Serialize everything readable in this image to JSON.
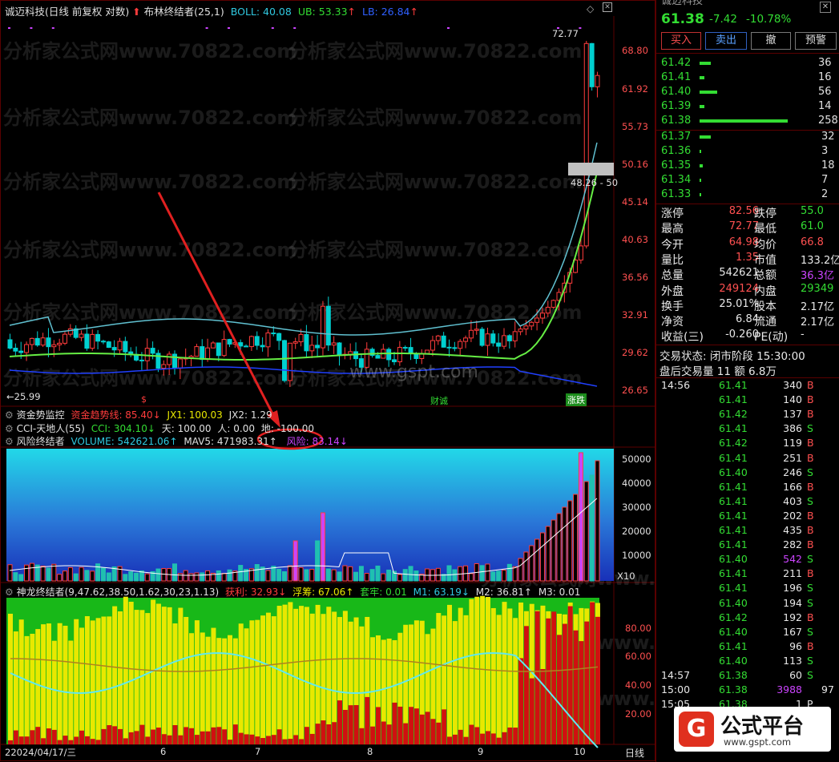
{
  "colors": {
    "up": "#ff3c3c",
    "down": "#00d0d0",
    "green": "#33dd33",
    "yellow": "#e8e800",
    "text": "#c8c8c8",
    "border": "#5a0000",
    "purple": "#cc44ff",
    "blue": "#3060ff",
    "cyan": "#30c8e0"
  },
  "header": {
    "stock": "诚迈科技",
    "mode": "(日线 前复权 对数)",
    "indicator": "布林终结者(25,1)",
    "boll_label": "BOLL: 40.08",
    "ub_label": "UB: 53.33",
    "lb_label": "LB: 26.84"
  },
  "main_chart": {
    "price_axis": [
      "68.80",
      "61.92",
      "55.73",
      "50.16",
      "45.14",
      "40.63",
      "36.56",
      "32.91",
      "29.62",
      "26.65"
    ],
    "high_label": "72.77",
    "low_label": "←25.99",
    "range_label": "48.26 - 50",
    "watermark_main": "分析家公式网www.70822.com",
    "watermark_site": "www.gspt.com",
    "tag_low": "$",
    "tag_cai": "财诚",
    "tag_zhangdie": "涨跌"
  },
  "indicators": {
    "row1": {
      "name": "资金势监控",
      "a": "资金趋势线: 85.40↓",
      "b": "JX1: 100.03",
      "c": "JX2: 1.29"
    },
    "row2": {
      "name": "CCI-天地人(55)",
      "a": "CCI: 304.10↓",
      "b": "天: 100.00",
      "c": "人: 0.00",
      "d": "地: -100.00"
    },
    "row3": {
      "name": "风险终结者",
      "a": "VOLUME: 542621.06↑",
      "b": "MAV5: 471983.31↑",
      "c": "风险: 83.14↓"
    }
  },
  "volume_panel": {
    "axis": [
      "50000",
      "40000",
      "30000",
      "20000",
      "10000"
    ],
    "unit": "X10"
  },
  "dragon_panel": {
    "title": "神龙终结者(9,47.62,38.50,1.62,30,23,1.13)",
    "a": "获利: 32.93↓",
    "b": "浮筹: 67.06↑",
    "c": "套牢: 0.01",
    "d": "M1: 63.19↓",
    "e": "M2: 36.81↑",
    "f": "M3: 0.01",
    "axis": [
      "80.00",
      "60.00",
      "40.00",
      "20.00"
    ]
  },
  "date_axis": {
    "start": "22024/04/17/三",
    "months": [
      "6",
      "7",
      "8",
      "9",
      "10"
    ],
    "period": "日线"
  },
  "side": {
    "name_partial": "诚迈科技",
    "price": "61.38",
    "change": "-7.42",
    "pct": "-10.78%",
    "buttons": [
      "买入",
      "卖出",
      "撤",
      "预警"
    ],
    "asks": [
      {
        "p": "61.42",
        "v": "36"
      },
      {
        "p": "61.41",
        "v": "16"
      },
      {
        "p": "61.40",
        "v": "56"
      },
      {
        "p": "61.39",
        "v": "14"
      },
      {
        "p": "61.38",
        "v": "258"
      }
    ],
    "bids": [
      {
        "p": "61.37",
        "v": "32"
      },
      {
        "p": "61.36",
        "v": "3"
      },
      {
        "p": "61.35",
        "v": "18"
      },
      {
        "p": "61.34",
        "v": "7"
      },
      {
        "p": "61.33",
        "v": "2"
      }
    ],
    "info": [
      {
        "k1": "涨停",
        "v1": "82.56",
        "k2": "跌停",
        "v2": "55.0"
      },
      {
        "k1": "最高",
        "v1": "72.77",
        "k2": "最低",
        "v2": "61.0"
      },
      {
        "k1": "今开",
        "v1": "64.98",
        "k2": "均价",
        "v2": "66.8"
      },
      {
        "k1": "量比",
        "v1": "1.35",
        "k2": "市值",
        "v2": "133.2亿"
      },
      {
        "k1": "总量",
        "v1": "542621",
        "k2": "总额",
        "v2": "36.3亿"
      },
      {
        "k1": "外盘",
        "v1": "249124",
        "k2": "内盘",
        "v2": "29349"
      },
      {
        "k1": "换手",
        "v1": "25.01%",
        "k2": "股本",
        "v2": "2.17亿"
      },
      {
        "k1": "净资",
        "v1": "6.84",
        "k2": "流通",
        "v2": "2.17亿"
      },
      {
        "k1": "收益(三)",
        "v1": "-0.260",
        "k2": "PE(动)",
        "v2": "-"
      }
    ],
    "status1": "交易状态: 闭市阶段 15:30:00",
    "status2": "盘后交易量 11 额 6.8万",
    "ticks": [
      {
        "t": "14:56",
        "p": "61.41",
        "v": "340",
        "d": "B"
      },
      {
        "t": "",
        "p": "61.41",
        "v": "140",
        "d": "B"
      },
      {
        "t": "",
        "p": "61.42",
        "v": "137",
        "d": "B"
      },
      {
        "t": "",
        "p": "61.41",
        "v": "386",
        "d": "S"
      },
      {
        "t": "",
        "p": "61.42",
        "v": "119",
        "d": "B"
      },
      {
        "t": "",
        "p": "61.41",
        "v": "251",
        "d": "B"
      },
      {
        "t": "",
        "p": "61.40",
        "v": "246",
        "d": "S"
      },
      {
        "t": "",
        "p": "61.41",
        "v": "166",
        "d": "B"
      },
      {
        "t": "",
        "p": "61.41",
        "v": "403",
        "d": "S"
      },
      {
        "t": "",
        "p": "61.41",
        "v": "202",
        "d": "B"
      },
      {
        "t": "",
        "p": "61.41",
        "v": "435",
        "d": "B"
      },
      {
        "t": "",
        "p": "61.41",
        "v": "282",
        "d": "B"
      },
      {
        "t": "",
        "p": "61.40",
        "v": "542",
        "d": "S"
      },
      {
        "t": "",
        "p": "61.41",
        "v": "211",
        "d": "B"
      },
      {
        "t": "",
        "p": "61.41",
        "v": "196",
        "d": "S"
      },
      {
        "t": "",
        "p": "61.40",
        "v": "194",
        "d": "S"
      },
      {
        "t": "",
        "p": "61.42",
        "v": "192",
        "d": "B"
      },
      {
        "t": "",
        "p": "61.40",
        "v": "167",
        "d": "S"
      },
      {
        "t": "",
        "p": "61.41",
        "v": "96",
        "d": "B"
      },
      {
        "t": "",
        "p": "61.40",
        "v": "113",
        "d": "S"
      },
      {
        "t": "14:57",
        "p": "61.38",
        "v": "60",
        "d": "S"
      },
      {
        "t": "15:00",
        "p": "61.38",
        "v": "3988",
        "d": ""
      },
      {
        "t": "15:05",
        "p": "61.38",
        "v": "1",
        "d": "P"
      }
    ],
    "tick_extra_1500": "97",
    "logo_text": "公式平台",
    "logo_url": "www.gspt.com"
  }
}
